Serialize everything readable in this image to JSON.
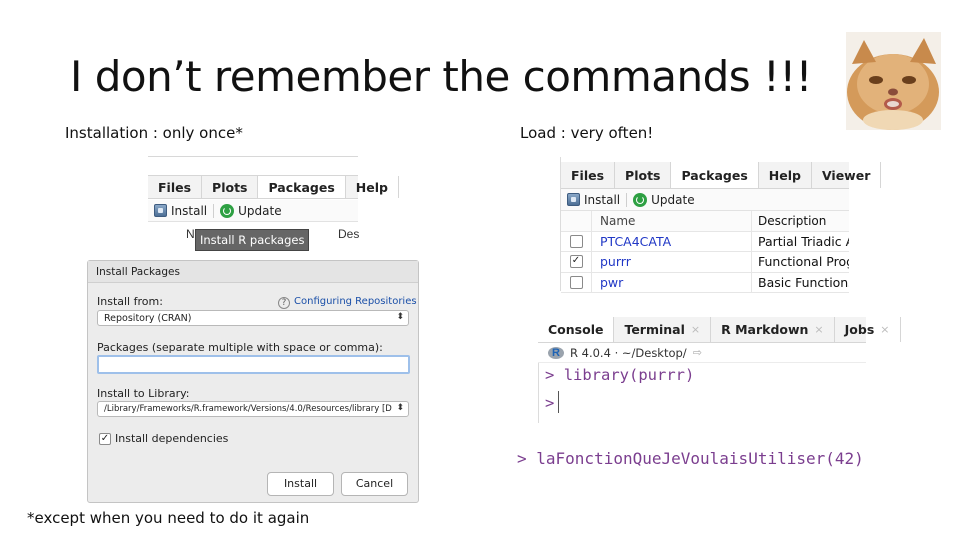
{
  "slide": {
    "title": "I don’t remember the commands !!!",
    "install_caption": "Installation : only once*",
    "load_caption": "Load : very often!",
    "footnote": "*except when you need to do it again"
  },
  "left_pane": {
    "tabs": [
      "Files",
      "Plots",
      "Packages",
      "Help"
    ],
    "active_tab": "Packages",
    "install_label": "Install",
    "update_label": "Update",
    "col_name_partial": "N",
    "col_desc_partial": "Des",
    "tooltip": "Install R packages"
  },
  "dialog": {
    "title": "Install Packages",
    "install_from_label": "Install from:",
    "configuring_link": "Configuring Repositories",
    "install_from_value": "Repository (CRAN)",
    "packages_label": "Packages (separate multiple with space or comma):",
    "packages_value": "",
    "library_label": "Install to Library:",
    "library_value": "/Library/Frameworks/R.framework/Versions/4.0/Resources/library [D",
    "dependencies_label": "Install dependencies",
    "dependencies_checked": true,
    "install_button": "Install",
    "cancel_button": "Cancel"
  },
  "right_pane": {
    "tabs": [
      "Files",
      "Plots",
      "Packages",
      "Help",
      "Viewer"
    ],
    "active_tab": "Packages",
    "install_label": "Install",
    "update_label": "Update",
    "columns": [
      "Name",
      "Description"
    ],
    "rows": [
      {
        "checked": false,
        "name": "PTCA4CATA",
        "description": "Partial Triadic An"
      },
      {
        "checked": true,
        "name": "purrr",
        "description": "Functional Progra"
      },
      {
        "checked": false,
        "name": "pwr",
        "description": "Basic Functions f"
      }
    ]
  },
  "console": {
    "tabs": [
      "Console",
      "Terminal",
      "R Markdown",
      "Jobs"
    ],
    "active_tab": "Console",
    "close_glyph": "×",
    "r_version_path": "R 4.0.4 · ~/Desktop/",
    "line1_prompt": ">",
    "line1_code": "library(purrr)",
    "line2_prompt": ">"
  },
  "big_command": "> laFonctionQueJeVoulaisUtiliser(42)"
}
